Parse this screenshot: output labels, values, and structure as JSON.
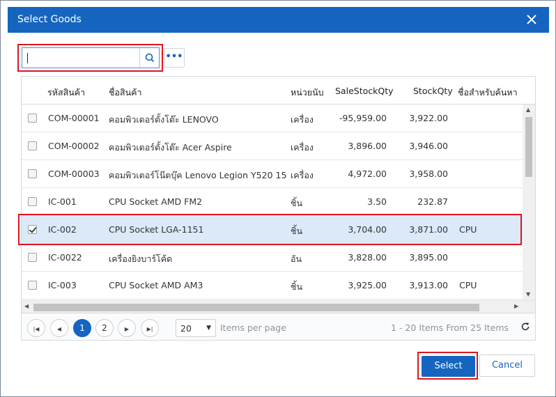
{
  "dialog": {
    "title": "Select Goods",
    "close_icon": "close-icon"
  },
  "search": {
    "value": "",
    "placeholder": "",
    "search_icon": "search-icon",
    "more_label": "•••"
  },
  "table": {
    "columns": [
      "รหัสสินค้า",
      "ชื่อสินค้า",
      "หน่วยนับ",
      "SaleStockQty",
      "StockQty",
      "ชื่อสำหรับค้นหา"
    ],
    "rows": [
      {
        "checked": false,
        "code": "COM-00001",
        "name": "คอมพิวเตอร์ตั้งโต๊ะ LENOVO",
        "unit": "เครื่อง",
        "sale_qty": "-95,959.00",
        "stock_qty": "3,922.00",
        "search_name": ""
      },
      {
        "checked": false,
        "code": "COM-00002",
        "name": "คอมพิวเตอร์ตั้งโต๊ะ Acer Aspire",
        "unit": "เครื่อง",
        "sale_qty": "3,896.00",
        "stock_qty": "3,946.00",
        "search_name": ""
      },
      {
        "checked": false,
        "code": "COM-00003",
        "name": "คอมพิวเตอร์โน๊ตบุ๊ค Lenovo Legion Y520 15",
        "unit": "เครื่อง",
        "sale_qty": "4,972.00",
        "stock_qty": "3,958.00",
        "search_name": ""
      },
      {
        "checked": false,
        "code": "IC-001",
        "name": "CPU Socket AMD FM2",
        "unit": "ชิ้น",
        "sale_qty": "3.50",
        "stock_qty": "232.87",
        "search_name": ""
      },
      {
        "checked": true,
        "code": "IC-002",
        "name": "CPU Socket LGA-1151",
        "unit": "ชิ้น",
        "sale_qty": "3,704.00",
        "stock_qty": "3,871.00",
        "search_name": "CPU"
      },
      {
        "checked": false,
        "code": "IC-0022",
        "name": "เครื่องยิงบาร์โค้ด",
        "unit": "อัน",
        "sale_qty": "3,828.00",
        "stock_qty": "3,895.00",
        "search_name": ""
      },
      {
        "checked": false,
        "code": "IC-003",
        "name": "CPU Socket AMD AM3",
        "unit": "ชิ้น",
        "sale_qty": "3,925.00",
        "stock_qty": "3,913.00",
        "search_name": "CPU"
      }
    ]
  },
  "pager": {
    "pages": [
      "1",
      "2"
    ],
    "current_page": "1",
    "page_size": "20",
    "items_per_page_label": "Items per page",
    "info": "1 - 20 Items From 25 Items",
    "refresh_icon": "refresh-icon"
  },
  "footer": {
    "select_label": "Select",
    "cancel_label": "Cancel"
  },
  "colors": {
    "primary": "#1565c0",
    "highlight": "#e0141e",
    "selected_row": "#dbe9f8"
  }
}
